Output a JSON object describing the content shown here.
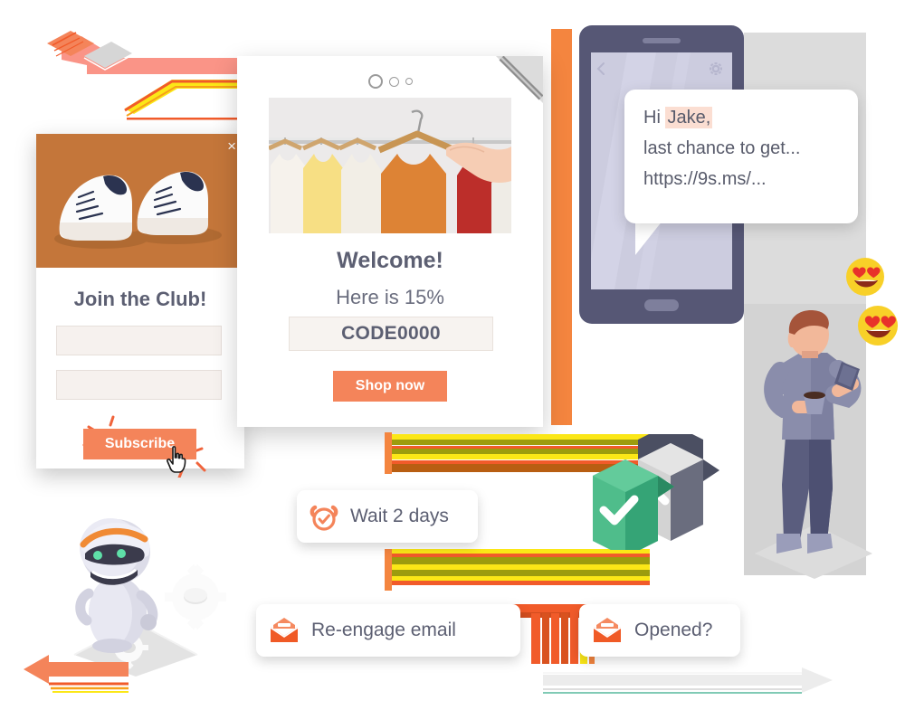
{
  "popup": {
    "name": "signup-popup",
    "close_label": "×",
    "title": "Join the Club!",
    "field1_placeholder": "",
    "field1_value": "",
    "field2_placeholder": "",
    "field2_value": "",
    "subscribe_label": "Subscribe",
    "image_alt": "white-sneakers-photo",
    "image_bg": "#c4763a",
    "accent": "#f4845a"
  },
  "email": {
    "name": "welcome-email-card",
    "heading": "Welcome!",
    "subheading": "Here is 15%",
    "promo_code": "CODE0000",
    "cta_label": "Shop now",
    "image_alt": "clothes-on-hangers-photo",
    "accent": "#f4845a"
  },
  "phone": {
    "name": "sms-phone",
    "back_icon": "chevron-left-icon",
    "settings_icon": "gear-icon",
    "compose_plus_icon": "plus-icon",
    "send_icon": "send-icon",
    "bubble": {
      "line1_prefix": "Hi ",
      "line1_token": "Jake,",
      "line2": "last chance to get...",
      "line3": "https://9s.ms/...",
      "token_highlight": "#fbded2"
    },
    "body_color": "#565775",
    "screen_color": "#ccccdf"
  },
  "workflow": {
    "cards": [
      {
        "id": "wait-2-days",
        "label": "Wait 2 days",
        "icon": "alarm-clock-check-icon"
      },
      {
        "id": "re-engage-email",
        "label": "Re-engage email",
        "icon": "open-envelope-icon"
      },
      {
        "id": "opened",
        "label": "Opened?",
        "icon": "open-envelope-icon"
      }
    ],
    "badges": [
      {
        "id": "yes-branch",
        "icon": "check-icon",
        "color": "#4fbd8b"
      },
      {
        "id": "no-branch",
        "icon": "close-x-icon",
        "color": "#9a9a9a"
      }
    ]
  },
  "decor": {
    "robot": "automation-robot-illustration",
    "gears": "gear-icon",
    "person": "person-with-phone-illustration",
    "emoji": "heart-eyes-emoji",
    "arrow_top_left": "flow-arrow-up-left",
    "arrow_bottom_left": "flow-arrow-left",
    "arrow_bottom_right": "flow-arrow-right",
    "colors": {
      "orange": "#f15b2a",
      "peach": "#f4845a",
      "salmon": "#fa9487",
      "yellow": "#fbe717",
      "olive": "#9c9c0e",
      "green": "#4fbd8b",
      "gray": "#9a9a9a",
      "slate": "#565775"
    }
  }
}
